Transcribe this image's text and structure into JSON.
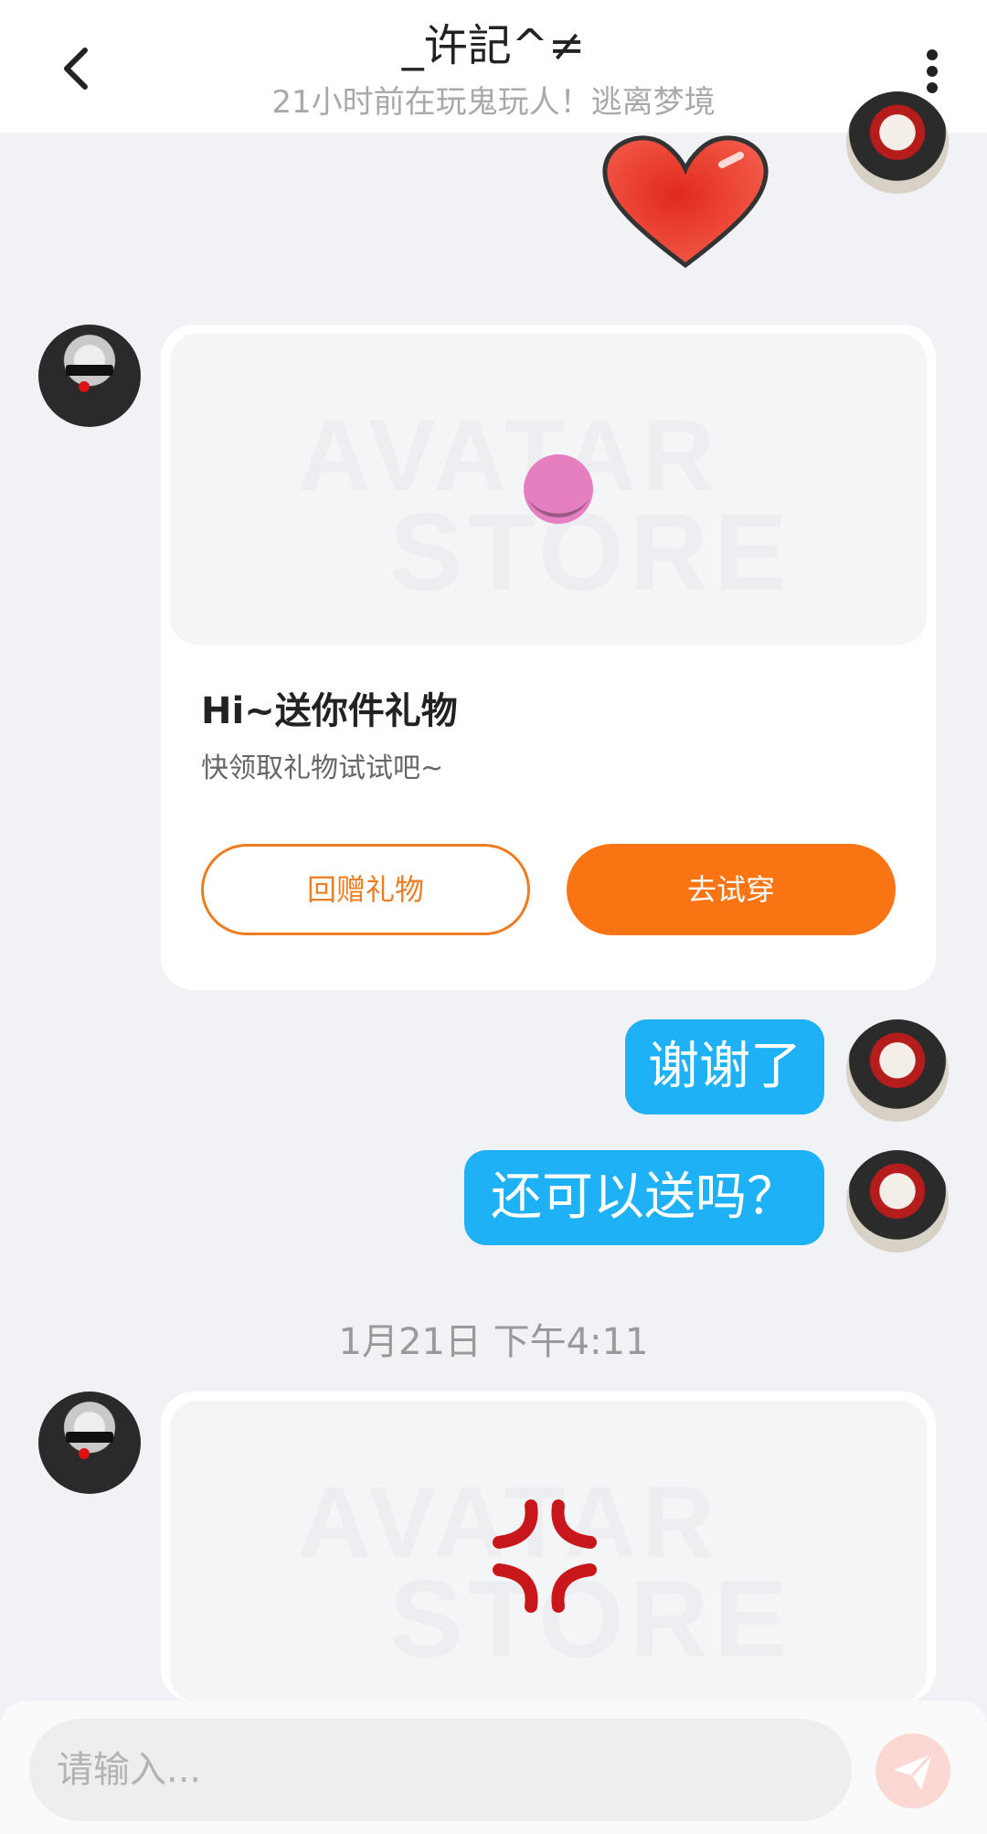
{
  "header": {
    "title": "_许記^≠",
    "subtitle": "21小时前在玩鬼玩人！逃离梦境"
  },
  "gift_card_1": {
    "watermark_line1": "AVATAR",
    "watermark_line2": "STORE",
    "title": "Hi~送你件礼物",
    "description": "快领取礼物试试吧~",
    "return_gift_label": "回赠礼物",
    "try_on_label": "去试穿"
  },
  "messages": [
    {
      "text": "谢谢了"
    },
    {
      "text": "还可以送吗？"
    }
  ],
  "timestamp": "1月21日 下午4:11",
  "gift_card_2": {
    "watermark_line1": "AVATAR",
    "watermark_line2": "STORE"
  },
  "input": {
    "placeholder": "请输入..."
  },
  "colors": {
    "accent_orange": "#fb7413",
    "bubble_blue": "#1fb1f5",
    "send_button": "#fbd8d4"
  }
}
